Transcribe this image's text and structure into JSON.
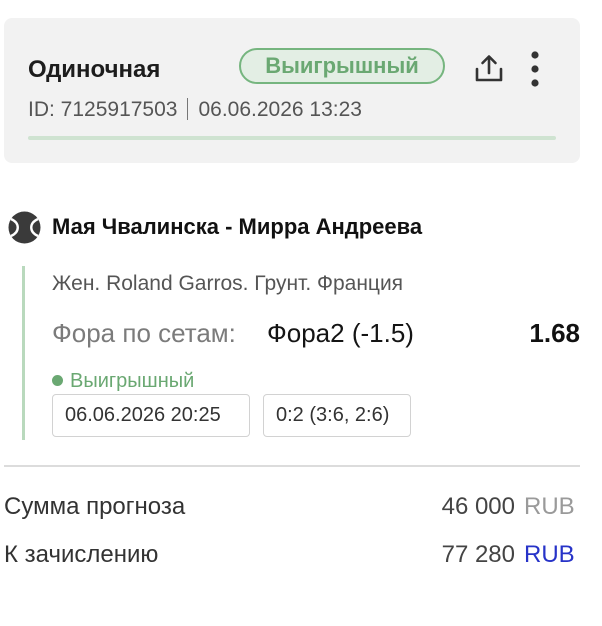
{
  "header": {
    "bet_type": "Одиночная",
    "status": "Выигрышный",
    "id_text": "ID: 7125917503",
    "datetime": "06.06.2026 13:23",
    "status_color": "#6aa872",
    "progress": 1.0
  },
  "icons": {
    "share": "share-icon",
    "more": "more-vertical-icon",
    "sport": "tennis-ball-icon"
  },
  "event": {
    "title": "Мая Чвалинска - Мирра Андреева",
    "tournament": "Жен. Roland Garros. Грунт. Франция",
    "market_label": "Фора по сетам:",
    "outcome": "Фора2 (-1.5)",
    "odds": "1.68",
    "status": "Выигрышный",
    "start_datetime": "06.06.2026 20:25",
    "score": "0:2 (3:6, 2:6)"
  },
  "summary": {
    "stake_label": "Сумма прогноза",
    "stake_amount": "46 000",
    "stake_currency": "RUB",
    "payout_label": "К зачислению",
    "payout_amount": "77 280",
    "payout_currency": "RUB"
  },
  "colors": {
    "accent_green": "#6aa872",
    "currency_link_blue": "#2733c8",
    "card_background": "#f2f2f2"
  }
}
